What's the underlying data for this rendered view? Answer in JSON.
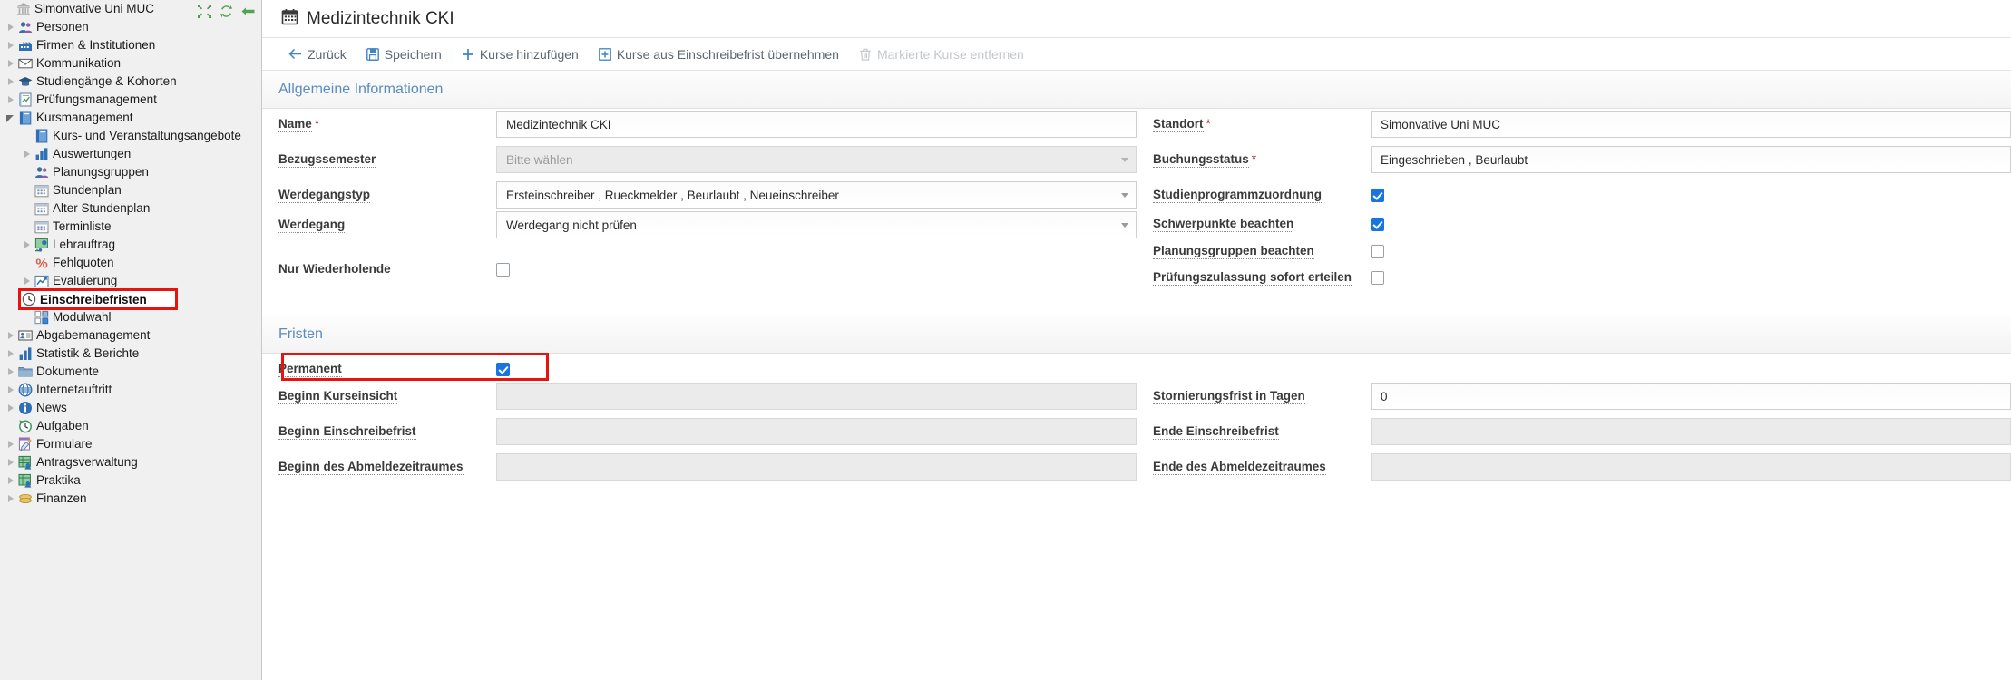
{
  "sidebar": {
    "toolbar_icons": [
      {
        "name": "collapse-all-icon",
        "title": "Alle einklappen"
      },
      {
        "name": "refresh-icon",
        "title": "Aktualisieren"
      },
      {
        "name": "back-arrow-icon",
        "title": "Zurück"
      }
    ],
    "items": [
      {
        "label": "Simonvative Uni MUC",
        "level": 0,
        "twisty": "none",
        "icon": "bank-icon",
        "selected": false
      },
      {
        "label": "Personen",
        "level": 1,
        "twisty": "closed",
        "icon": "people-icon",
        "selected": false
      },
      {
        "label": "Firmen & Institutionen",
        "level": 1,
        "twisty": "closed",
        "icon": "factory-icon",
        "selected": false
      },
      {
        "label": "Kommunikation",
        "level": 1,
        "twisty": "closed",
        "icon": "envelope-icon",
        "selected": false
      },
      {
        "label": "Studiengänge & Kohorten",
        "level": 1,
        "twisty": "closed",
        "icon": "graduation-cap-icon",
        "selected": false
      },
      {
        "label": "Prüfungsmanagement",
        "level": 1,
        "twisty": "closed",
        "icon": "exam-list-icon",
        "selected": false
      },
      {
        "label": "Kursmanagement",
        "level": 1,
        "twisty": "open",
        "icon": "book-icon",
        "selected": false
      },
      {
        "label": "Kurs- und Veranstaltungsangebote",
        "level": 2,
        "twisty": "none",
        "icon": "book-icon",
        "selected": false
      },
      {
        "label": "Auswertungen",
        "level": 2,
        "twisty": "closed",
        "icon": "bar-chart-icon",
        "selected": false
      },
      {
        "label": "Planungsgruppen",
        "level": 2,
        "twisty": "none",
        "icon": "people-icon",
        "selected": false
      },
      {
        "label": "Stundenplan",
        "level": 2,
        "twisty": "none",
        "icon": "calendar-icon",
        "selected": false
      },
      {
        "label": "Alter Stundenplan",
        "level": 2,
        "twisty": "none",
        "icon": "calendar-icon",
        "selected": false
      },
      {
        "label": "Terminliste",
        "level": 2,
        "twisty": "none",
        "icon": "calendar-icon",
        "selected": false
      },
      {
        "label": "Lehrauftrag",
        "level": 2,
        "twisty": "closed",
        "icon": "teaching-assignment-icon",
        "selected": false
      },
      {
        "label": "Fehlquoten",
        "level": 2,
        "twisty": "none",
        "icon": "percent-icon",
        "selected": false
      },
      {
        "label": "Evaluierung",
        "level": 2,
        "twisty": "closed",
        "icon": "trend-chart-icon",
        "selected": false
      },
      {
        "label": "Einschreibefristen",
        "level": 2,
        "twisty": "none",
        "icon": "clock-icon",
        "selected": true
      },
      {
        "label": "Modulwahl",
        "level": 2,
        "twisty": "none",
        "icon": "modules-icon",
        "selected": false
      },
      {
        "label": "Abgabemanagement",
        "level": 1,
        "twisty": "closed",
        "icon": "id-card-icon",
        "selected": false
      },
      {
        "label": "Statistik & Berichte",
        "level": 1,
        "twisty": "closed",
        "icon": "bar-chart-icon",
        "selected": false
      },
      {
        "label": "Dokumente",
        "level": 1,
        "twisty": "closed",
        "icon": "folder-icon",
        "selected": false
      },
      {
        "label": "Internetauftritt",
        "level": 1,
        "twisty": "closed",
        "icon": "globe-icon",
        "selected": false
      },
      {
        "label": "News",
        "level": 1,
        "twisty": "closed",
        "icon": "info-icon",
        "selected": false
      },
      {
        "label": "Aufgaben",
        "level": 1,
        "twisty": "none",
        "icon": "task-clock-icon",
        "selected": false
      },
      {
        "label": "Formulare",
        "level": 1,
        "twisty": "closed",
        "icon": "form-icon",
        "selected": false
      },
      {
        "label": "Antragsverwaltung",
        "level": 1,
        "twisty": "closed",
        "icon": "table-people-icon",
        "selected": false
      },
      {
        "label": "Praktika",
        "level": 1,
        "twisty": "closed",
        "icon": "table-people-icon",
        "selected": false
      },
      {
        "label": "Finanzen",
        "level": 1,
        "twisty": "closed",
        "icon": "coins-icon",
        "selected": false
      }
    ],
    "highlight_label": "Einschreibefristen"
  },
  "header": {
    "icon": "calendar-grid-icon",
    "title": "Medizintechnik CKI"
  },
  "toolbar": {
    "buttons": [
      {
        "label": "Zurück",
        "icon": "arrow-left-icon",
        "disabled": false
      },
      {
        "label": "Speichern",
        "icon": "save-disk-icon",
        "disabled": false
      },
      {
        "label": "Kurse hinzufügen",
        "icon": "plus-icon",
        "disabled": false
      },
      {
        "label": "Kurse aus Einschreibefrist übernehmen",
        "icon": "plus-box-icon",
        "disabled": false
      },
      {
        "label": "Markierte Kurse entfernen",
        "icon": "trash-icon",
        "disabled": true
      }
    ]
  },
  "sections": {
    "general": {
      "title": "Allgemeine Informationen",
      "left_fields": [
        {
          "label": "Name",
          "required": true,
          "type": "text",
          "value": "Medizintechnik CKI",
          "disabled": false
        },
        {
          "label": "Bezugssemester",
          "required": false,
          "type": "select",
          "value": "Bitte wählen",
          "placeholder": true,
          "disabled": true
        },
        {
          "label": "Werdegangstyp",
          "required": false,
          "type": "select",
          "value": "Ersteinschreiber , Rueckmelder , Beurlaubt , Neueinschreiber",
          "placeholder": false,
          "disabled": false
        },
        {
          "label": "Werdegang",
          "required": false,
          "type": "select",
          "value": "Werdegang nicht prüfen",
          "placeholder": false,
          "disabled": false
        },
        {
          "label": "Nur Wiederholende",
          "required": false,
          "type": "checkbox",
          "checked": false
        }
      ],
      "right_fields": [
        {
          "label": "Standort",
          "required": true,
          "type": "text",
          "value": "Simonvative Uni MUC",
          "disabled": false
        },
        {
          "label": "Buchungsstatus",
          "required": true,
          "type": "text",
          "value": "Eingeschrieben , Beurlaubt",
          "disabled": false
        },
        {
          "label": "Studienprogrammzuordnung",
          "required": false,
          "type": "checkbox",
          "checked": true
        },
        {
          "label": "Schwerpunkte beachten",
          "required": false,
          "type": "checkbox",
          "checked": true
        },
        {
          "label": "Planungsgruppen beachten",
          "required": false,
          "type": "checkbox",
          "checked": false
        },
        {
          "label": "Prüfungszulassung sofort erteilen",
          "required": false,
          "type": "checkbox",
          "checked": false
        }
      ]
    },
    "deadlines": {
      "title": "Fristen",
      "left_fields": [
        {
          "label": "Permanent",
          "required": false,
          "type": "checkbox",
          "checked": true,
          "highlighted": true
        },
        {
          "label": "Beginn Kurseinsicht",
          "required": false,
          "type": "text",
          "value": "",
          "disabled": true
        },
        {
          "label": "Beginn Einschreibefrist",
          "required": false,
          "type": "text",
          "value": "",
          "disabled": true
        },
        {
          "label": "Beginn des Abmeldezeitraumes",
          "required": false,
          "type": "text",
          "value": "",
          "disabled": true
        }
      ],
      "right_fields": [
        {
          "label": "",
          "required": false,
          "type": "blank"
        },
        {
          "label": "Stornierungsfrist in Tagen",
          "required": false,
          "type": "text",
          "value": "0",
          "disabled": false
        },
        {
          "label": "Ende Einschreibefrist",
          "required": false,
          "type": "text",
          "value": "",
          "disabled": true
        },
        {
          "label": "Ende des Abmeldezeitraumes",
          "required": false,
          "type": "text",
          "value": "",
          "disabled": true
        }
      ]
    }
  },
  "colors": {
    "accent": "#5b8cc0",
    "toolbar_icon": "#3d85c6",
    "highlight": "#e8120e",
    "checkbox_on": "#1775e0"
  }
}
